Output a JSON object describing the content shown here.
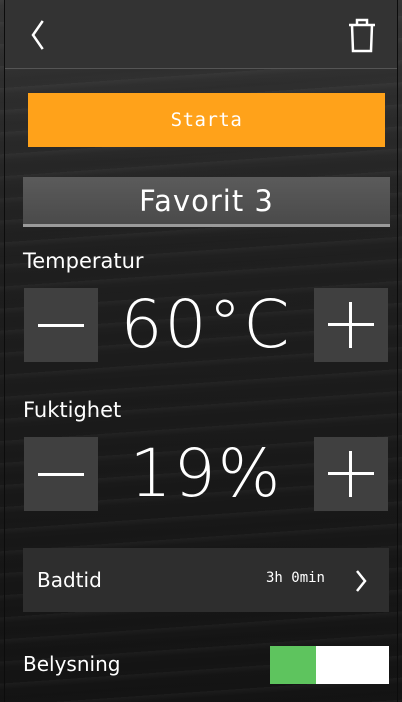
{
  "header": {
    "back_icon": "chevron-left-icon",
    "delete_icon": "trash-icon"
  },
  "start_button": {
    "label": "Starta",
    "color": "#ffa21a"
  },
  "favorite": {
    "name": "Favorit 3"
  },
  "temperature": {
    "label": "Temperatur",
    "value": "60°C",
    "minus_icon": "minus-icon",
    "plus_icon": "plus-icon"
  },
  "humidity": {
    "label": "Fuktighet",
    "value": "19%",
    "minus_icon": "minus-icon",
    "plus_icon": "plus-icon"
  },
  "bath_time": {
    "label": "Badtid",
    "value": "3h 0min",
    "chevron_icon": "chevron-right-icon"
  },
  "lighting": {
    "label": "Belysning",
    "toggle_on_color": "#5ec45e"
  }
}
